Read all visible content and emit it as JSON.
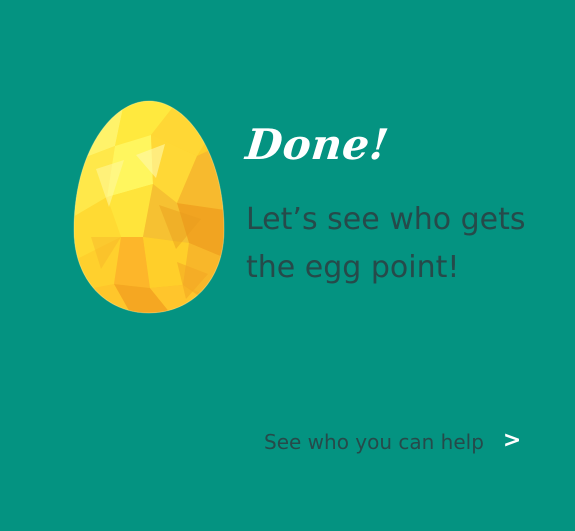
{
  "completion": {
    "headline": "Done!",
    "message_lines": [
      "Let’s see who gets",
      "the egg point!"
    ]
  },
  "help_link": {
    "label": "See who you can help",
    "chevron": ">"
  },
  "icons": {
    "egg": "golden-egg-icon"
  },
  "colors": {
    "background": "#049381",
    "headline": "#FFFFFF",
    "message": "#264A4A",
    "egg_primary": "#FFD42A",
    "egg_accent": "#F5A722"
  }
}
